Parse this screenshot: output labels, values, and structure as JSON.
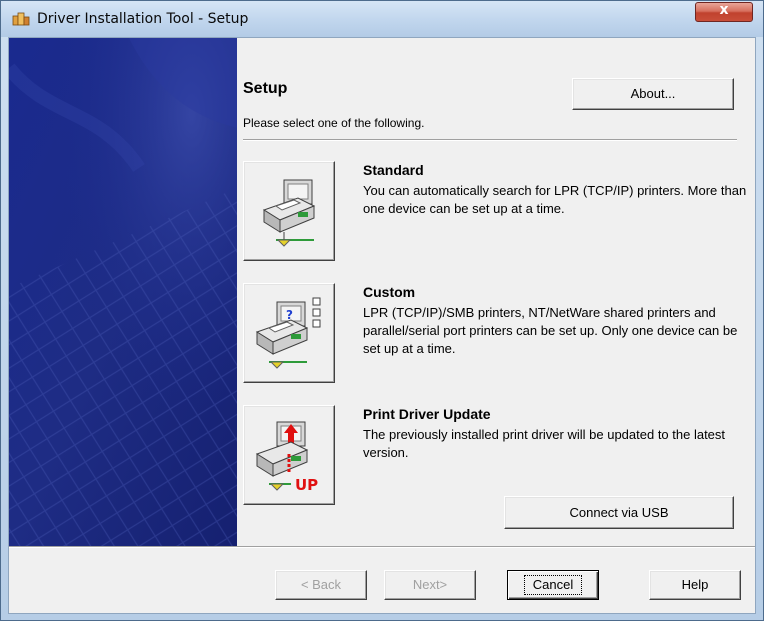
{
  "window": {
    "title": "Driver Installation Tool - Setup",
    "close_label": "x",
    "icon_name": "app-icon"
  },
  "header": {
    "title": "Setup",
    "instruction": "Please select one of the following.",
    "about_label": "About..."
  },
  "options": [
    {
      "title": "Standard",
      "description": "You can automatically search for LPR (TCP/IP) printers. More than one device can be set up at a time.",
      "icon_name": "network-printer-icon"
    },
    {
      "title": "Custom",
      "description": "LPR (TCP/IP)/SMB printers, NT/NetWare shared printers and parallel/serial port printers can be set up. Only one device can be set up at a time.",
      "icon_name": "custom-printer-icon"
    },
    {
      "title": "Print Driver Update",
      "description": "The previously installed print driver will be updated to the latest version.",
      "icon_name": "driver-update-icon",
      "badge": "UP"
    }
  ],
  "usb_label": "Connect via USB",
  "footer": {
    "back_label": "< Back",
    "next_label": "Next>",
    "cancel_label": "Cancel",
    "help_label": "Help"
  },
  "colors": {
    "sidebar": "#1c2a86",
    "accent_red": "#e01010",
    "printer_green": "#2e9b3a"
  }
}
